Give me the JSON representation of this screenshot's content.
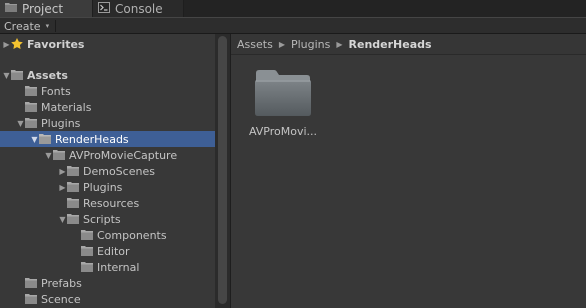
{
  "tabs": [
    {
      "label": "Project",
      "icon": "project-icon",
      "active": true
    },
    {
      "label": "Console",
      "icon": "console-icon",
      "active": false
    }
  ],
  "toolbar": {
    "create_label": "Create",
    "create_caret": "▾"
  },
  "tree": {
    "rows": [
      {
        "label": "Favorites",
        "icon": "star-icon",
        "expanded": false,
        "bold": true,
        "depth": 0
      },
      {
        "label": "Assets",
        "icon": "folder-icon",
        "expanded": true,
        "bold": true,
        "depth": 0
      },
      {
        "label": "Fonts",
        "icon": "folder-icon",
        "depth": 1
      },
      {
        "label": "Materials",
        "icon": "folder-icon",
        "depth": 1
      },
      {
        "label": "Plugins",
        "icon": "folder-icon",
        "expanded": true,
        "depth": 1
      },
      {
        "label": "RenderHeads",
        "icon": "folder-icon",
        "expanded": true,
        "selected": true,
        "depth": 2
      },
      {
        "label": "AVProMovieCapture",
        "icon": "folder-icon",
        "expanded": true,
        "depth": 3
      },
      {
        "label": "DemoScenes",
        "icon": "folder-icon",
        "expanded": false,
        "depth": 4
      },
      {
        "label": "Plugins",
        "icon": "folder-icon",
        "expanded": false,
        "depth": 4
      },
      {
        "label": "Resources",
        "icon": "folder-icon",
        "depth": 4
      },
      {
        "label": "Scripts",
        "icon": "folder-icon",
        "expanded": true,
        "depth": 4
      },
      {
        "label": "Components",
        "icon": "folder-icon",
        "depth": 5
      },
      {
        "label": "Editor",
        "icon": "folder-icon",
        "depth": 5
      },
      {
        "label": "Internal",
        "icon": "folder-icon",
        "depth": 5
      },
      {
        "label": "Prefabs",
        "icon": "folder-icon",
        "depth": 1
      },
      {
        "label": "Scence",
        "icon": "folder-icon",
        "depth": 1
      }
    ]
  },
  "breadcrumb": [
    "Assets",
    "Plugins",
    "RenderHeads"
  ],
  "breadcrumb_separator": "▶",
  "assets": [
    {
      "label": "AVProMovi...",
      "icon": "large-folder-icon"
    }
  ],
  "colors": {
    "background": "#383838",
    "selection": "#3e5f96",
    "tab_bar": "#232323"
  }
}
